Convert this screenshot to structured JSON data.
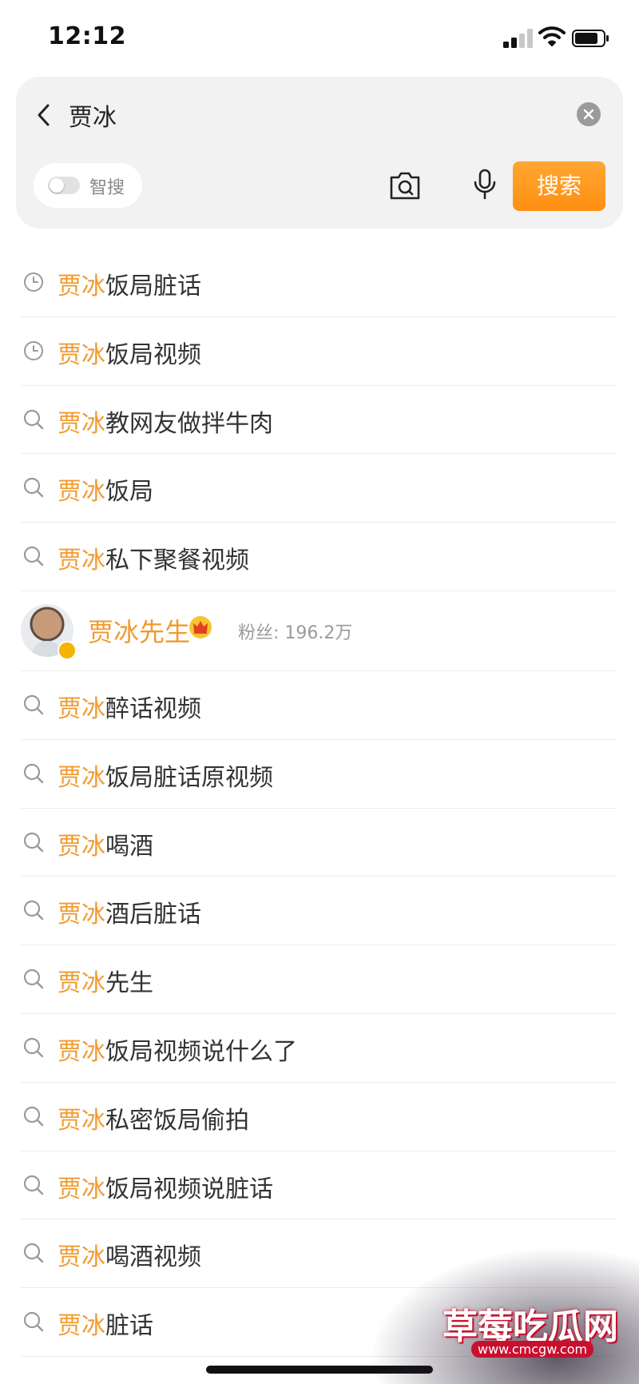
{
  "status_bar": {
    "time": "12:12"
  },
  "search": {
    "query": "贾冰",
    "smart_search_label": "智搜",
    "search_button_label": "搜索"
  },
  "colors": {
    "highlight": "#f29a2e",
    "search_button": "#ff9a1f"
  },
  "suggestions": [
    {
      "icon": "history-icon",
      "highlight": "贾冰",
      "rest": "饭局脏话"
    },
    {
      "icon": "history-icon",
      "highlight": "贾冰",
      "rest": "饭局视频"
    },
    {
      "icon": "search-icon",
      "highlight": "贾冰",
      "rest": "教网友做拌牛肉"
    },
    {
      "icon": "search-icon",
      "highlight": "贾冰",
      "rest": "饭局"
    },
    {
      "icon": "search-icon",
      "highlight": "贾冰",
      "rest": "私下聚餐视频"
    }
  ],
  "user_result": {
    "name": "贾冰先生",
    "followers": "粉丝: 196.2万",
    "badge_icon": "crown-icon"
  },
  "more_suggestions": [
    {
      "icon": "search-icon",
      "highlight": "贾冰",
      "rest": "醉话视频"
    },
    {
      "icon": "search-icon",
      "highlight": "贾冰",
      "rest": "饭局脏话原视频"
    },
    {
      "icon": "search-icon",
      "highlight": "贾冰",
      "rest": "喝酒"
    },
    {
      "icon": "search-icon",
      "highlight": "贾冰",
      "rest": "酒后脏话"
    },
    {
      "icon": "search-icon",
      "highlight": "贾冰",
      "rest": "先生"
    },
    {
      "icon": "search-icon",
      "highlight": "贾冰",
      "rest": "饭局视频说什么了"
    },
    {
      "icon": "search-icon",
      "highlight": "贾冰",
      "rest": "私密饭局偷拍"
    },
    {
      "icon": "search-icon",
      "highlight": "贾冰",
      "rest": "饭局视频说脏话"
    },
    {
      "icon": "search-icon",
      "highlight": "贾冰",
      "rest": "喝酒视频"
    },
    {
      "icon": "search-icon",
      "highlight": "贾冰",
      "rest": "脏话"
    }
  ],
  "watermark": {
    "text": "草莓吃瓜网",
    "url": "www.cmcgw.com"
  }
}
